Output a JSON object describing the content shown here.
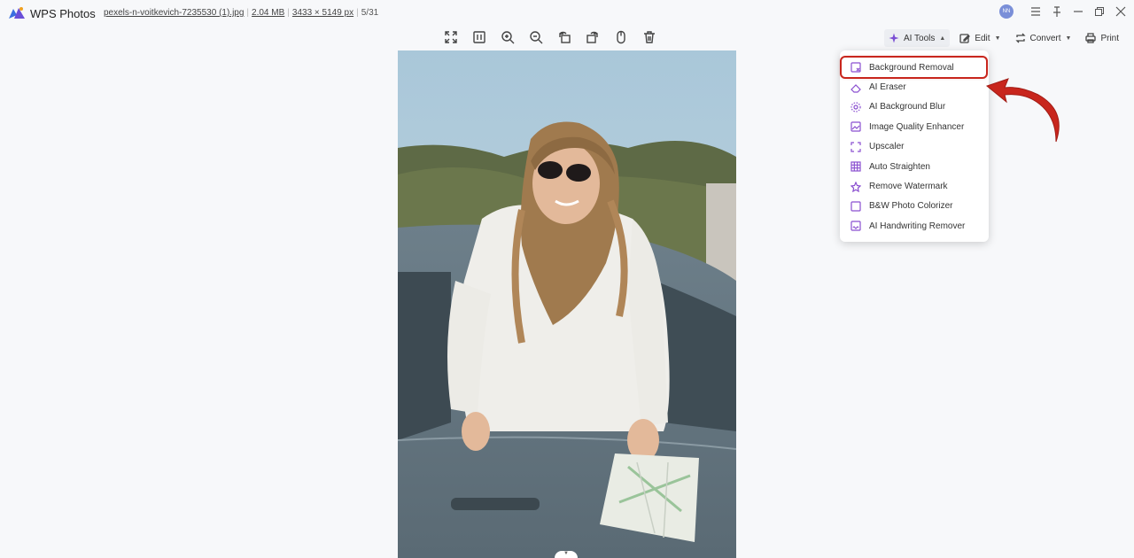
{
  "app": {
    "name": "WPS Photos",
    "logo_icon": "wps-photos-logo-icon"
  },
  "file": {
    "name": "pexels-n-voitkevich-7235530 (1).jpg",
    "size": "2.04 MB",
    "dimensions": "3433 × 5149 px",
    "position": "5/31"
  },
  "user": {
    "initials": "NN"
  },
  "toolbar_center": [
    {
      "name": "fit-screen-icon"
    },
    {
      "name": "actual-size-icon"
    },
    {
      "name": "zoom-in-icon"
    },
    {
      "name": "zoom-out-icon"
    },
    {
      "name": "rotate-left-icon"
    },
    {
      "name": "rotate-right-icon"
    },
    {
      "name": "mouse-icon"
    },
    {
      "name": "delete-icon"
    }
  ],
  "toolbar_right": {
    "ai_tools": "AI Tools",
    "edit": "Edit",
    "convert": "Convert",
    "print": "Print"
  },
  "ai_menu": {
    "items": [
      {
        "label": "Background Removal",
        "icon": "background-removal-icon"
      },
      {
        "label": "AI Eraser",
        "icon": "eraser-icon"
      },
      {
        "label": "AI Background Blur",
        "icon": "blur-icon"
      },
      {
        "label": "Image Quality Enhancer",
        "icon": "image-enhance-icon"
      },
      {
        "label": "Upscaler",
        "icon": "upscale-icon"
      },
      {
        "label": "Auto Straighten",
        "icon": "grid-icon"
      },
      {
        "label": "Remove Watermark",
        "icon": "watermark-icon"
      },
      {
        "label": "B&W Photo Colorizer",
        "icon": "colorize-icon"
      },
      {
        "label": "AI Handwriting Remover",
        "icon": "handwriting-icon"
      }
    ],
    "highlighted": "Background Removal"
  },
  "colors": {
    "highlight": "#c8261d",
    "accent": "#8a4fd0"
  }
}
